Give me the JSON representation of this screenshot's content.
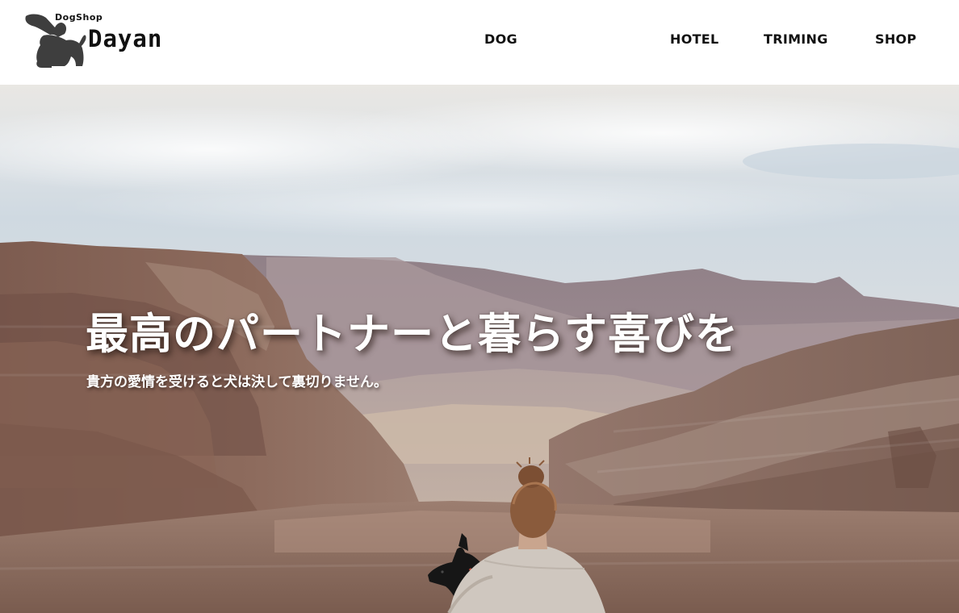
{
  "header": {
    "brand": {
      "tagline": "DogShop",
      "name": "Dayan",
      "logo_icon": "dog-silhouette-icon"
    },
    "nav": {
      "dog": "DOG",
      "hotel": "HOTEL",
      "triming": "TRIMING",
      "shop": "SHOP"
    }
  },
  "hero": {
    "headline": "最高のパートナーと暮らす喜びを",
    "subline": "貴方の愛情を受けると犬は決して裏切りません。",
    "image": "desert-canyon-person-with-dog-photo"
  },
  "colors": {
    "text": "#111111",
    "logo": "#3e3e3e",
    "hero_text": "#ffffff"
  }
}
